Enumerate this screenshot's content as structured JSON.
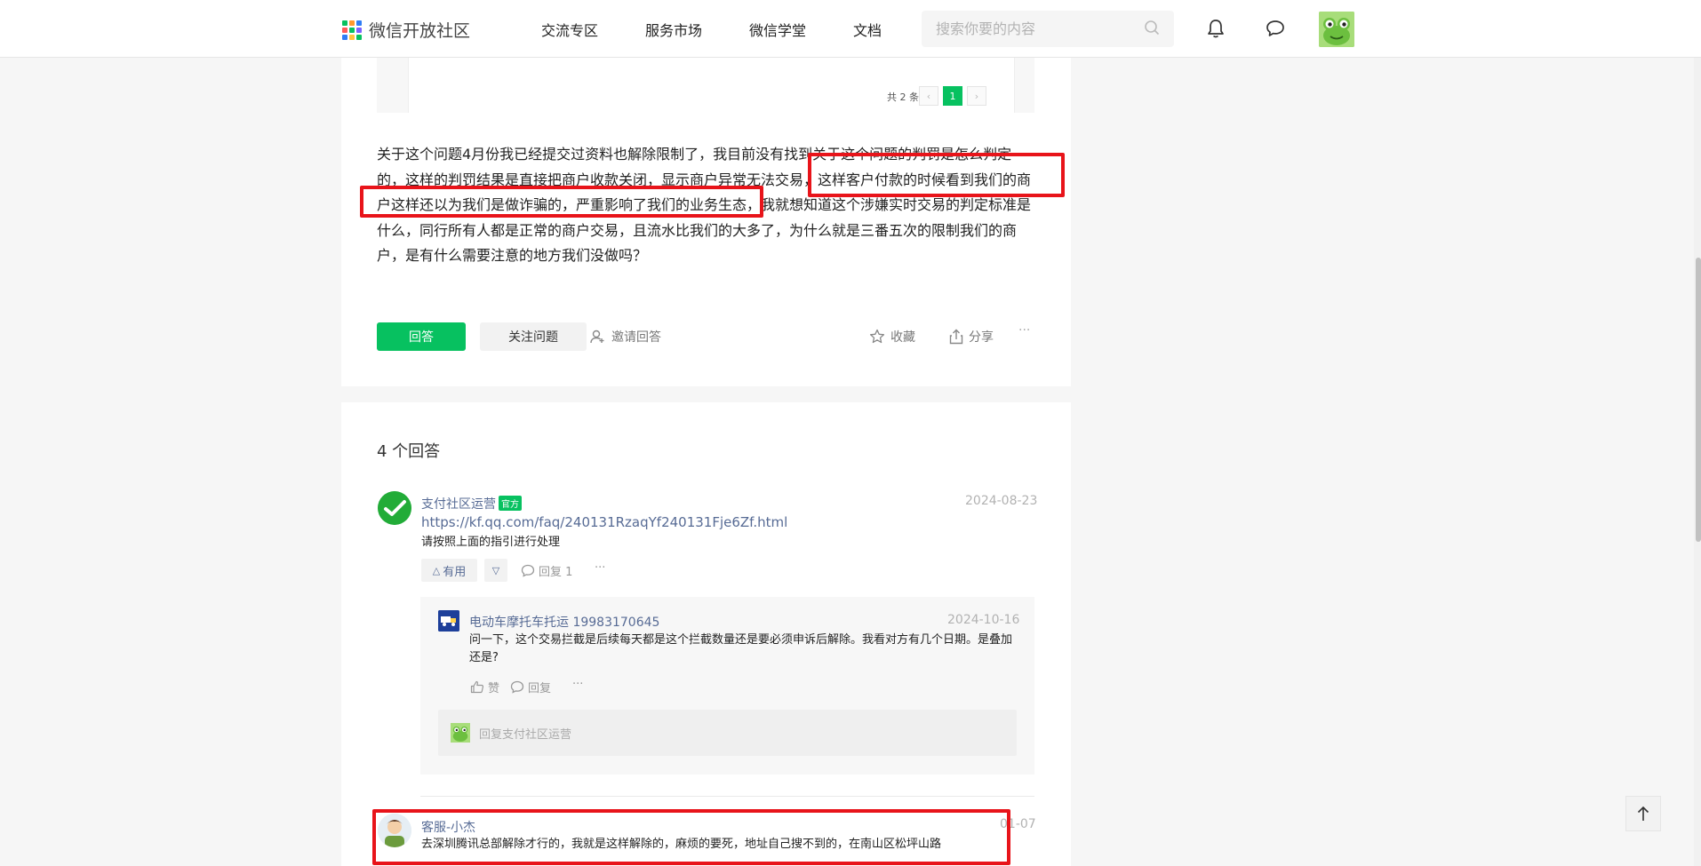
{
  "header": {
    "logo_text": "微信开放社区",
    "nav": [
      "交流专区",
      "服务市场",
      "微信学堂",
      "文档"
    ],
    "search_placeholder": "搜索你要的内容",
    "icons": [
      "bell-icon",
      "chat-bubble-icon",
      "search-icon"
    ]
  },
  "question": {
    "pagination": {
      "total": "共 2 条",
      "prev": "‹",
      "page": "1",
      "next": "›"
    },
    "body": "关于这个问题4月份我已经提交过资料也解除限制了，我目前没有找到关于这个问题的判罚是怎么判定的，这样的判罚结果是直接把商户收款关闭，显示商户异常无法交易，这样客户付款的时候看到我们的商户这样还以为我们是做诈骗的，严重影响了我们的业务生态，我就想知道这个涉嫌实时交易的判定标准是什么，同行所有人都是正常的商户交易，且流水比我们的大多了，为什么就是三番五次的限制我们的商户，是有什么需要注意的地方我们没做吗？",
    "answer_btn": "回答",
    "follow_btn": "关注问题",
    "invite": "邀请回答",
    "collect": "收藏",
    "share": "分享",
    "more": "···"
  },
  "answers": {
    "count_label": "4 个回答",
    "items": [
      {
        "author": "支付社区运营",
        "badge": "官方",
        "date": "2024-08-23",
        "link": "https://kf.qq.com/faq/240131RzaqYf240131Fje6Zf.html",
        "text": "请按照上面的指引进行处理",
        "useful": "有用",
        "reply": "回复 1",
        "more": "···",
        "replies": [
          {
            "author": "电动车摩托车托运 19983170645",
            "date": "2024-10-16",
            "text": "问一下，这个交易拦截是后续每天都是这个拦截数量还是要必须申诉后解除。我看对方有几个日期。是叠加还是?",
            "like": "赞",
            "reply": "回复",
            "more": "···"
          }
        ],
        "reply_placeholder": "回复支付社区运营"
      },
      {
        "author": "客服-小杰",
        "date": "01-07",
        "text": "去深圳腾讯总部解除才行的，我就是这样解除的，麻烦的要死，地址自己搜不到的，在南山区松坪山路"
      }
    ]
  },
  "colors": {
    "accent": "#07c160",
    "link": "#576b95",
    "annotation": "#e8141a"
  }
}
